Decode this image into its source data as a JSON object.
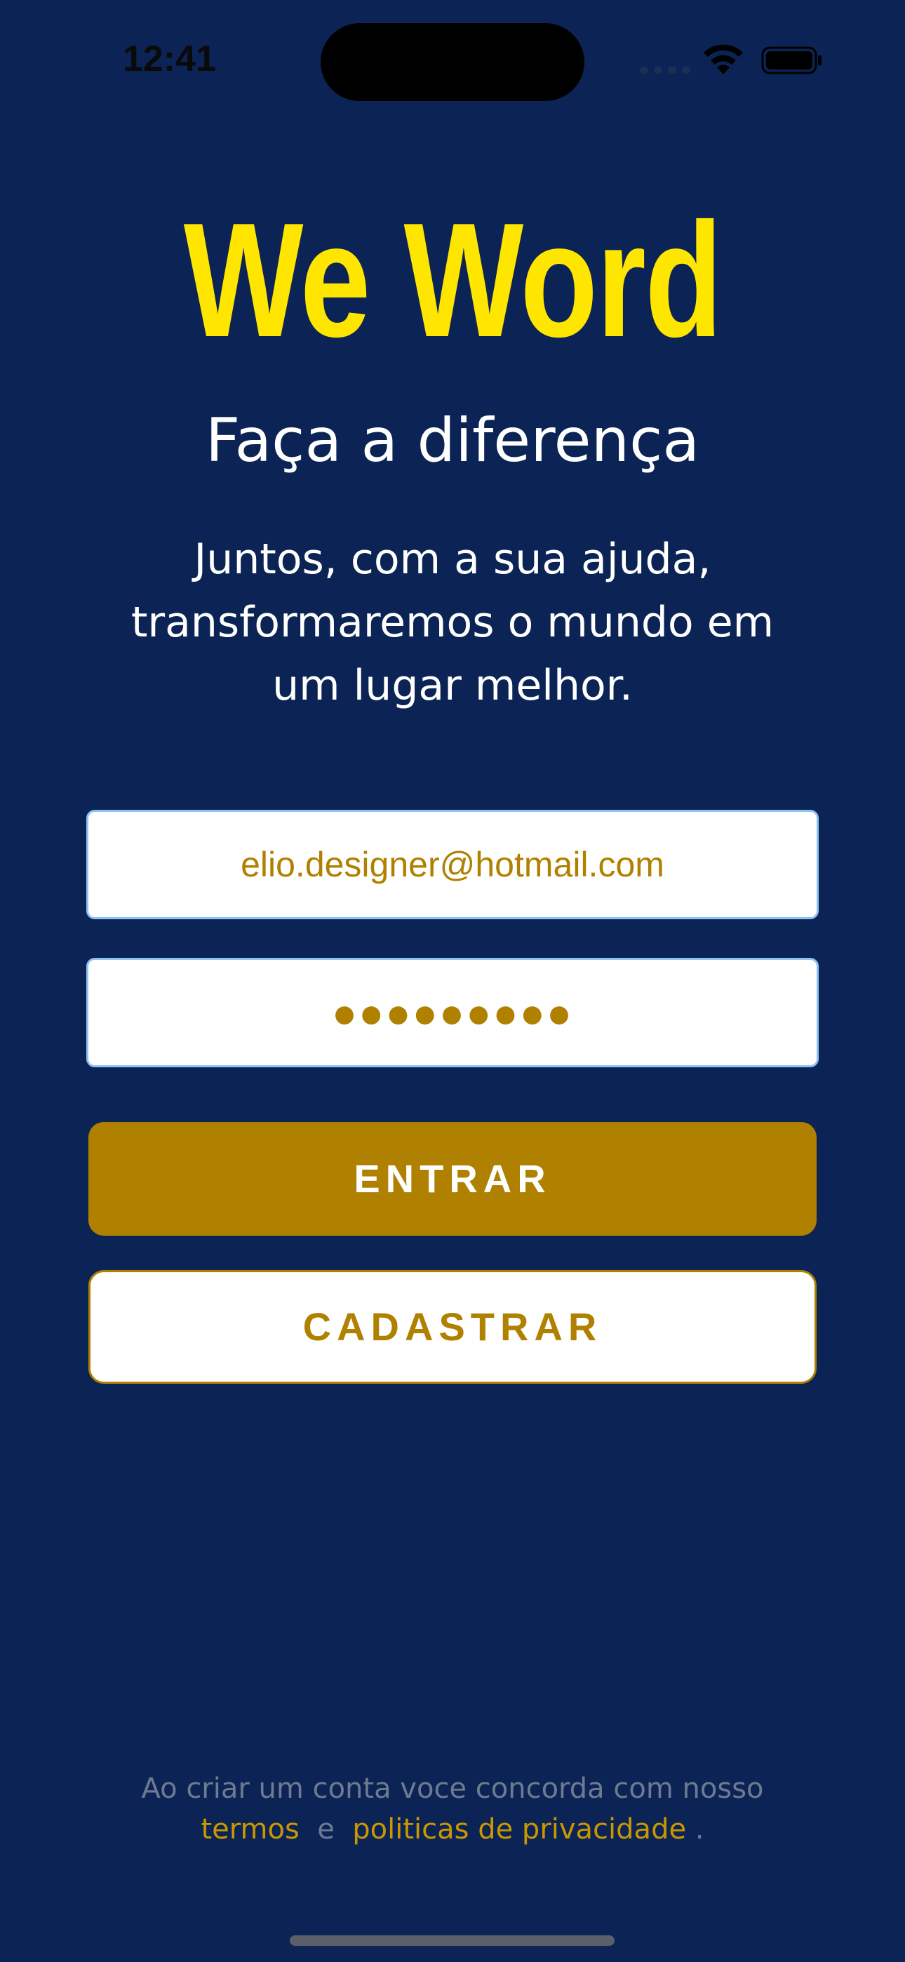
{
  "status_bar": {
    "time": "12:41",
    "icons": [
      "cellular-signal-icon",
      "wifi-icon",
      "battery-icon"
    ]
  },
  "brand": {
    "title": "We Word",
    "tagline": "Faça a diferença",
    "description": "Juntos, com a sua ajuda, transformaremos o mundo em um lugar melhor."
  },
  "login_form": {
    "email_value": "elio.designer@hotmail.com",
    "password_masked": "●●●●●●●●●",
    "enter_label": "ENTRAR",
    "register_label": "CADASTRAR"
  },
  "legal": {
    "prefix": "Ao criar um conta voce concorda com nosso",
    "terms_link": "termos",
    "conjunction": "e",
    "privacy_link": "politicas de privacidade",
    "suffix": "."
  },
  "colors": {
    "background": "#0B2455",
    "brand_yellow": "#FFE600",
    "accent_gold": "#B08100",
    "field_border": "#8EC2F2",
    "legal_text": "#6E7A90"
  }
}
